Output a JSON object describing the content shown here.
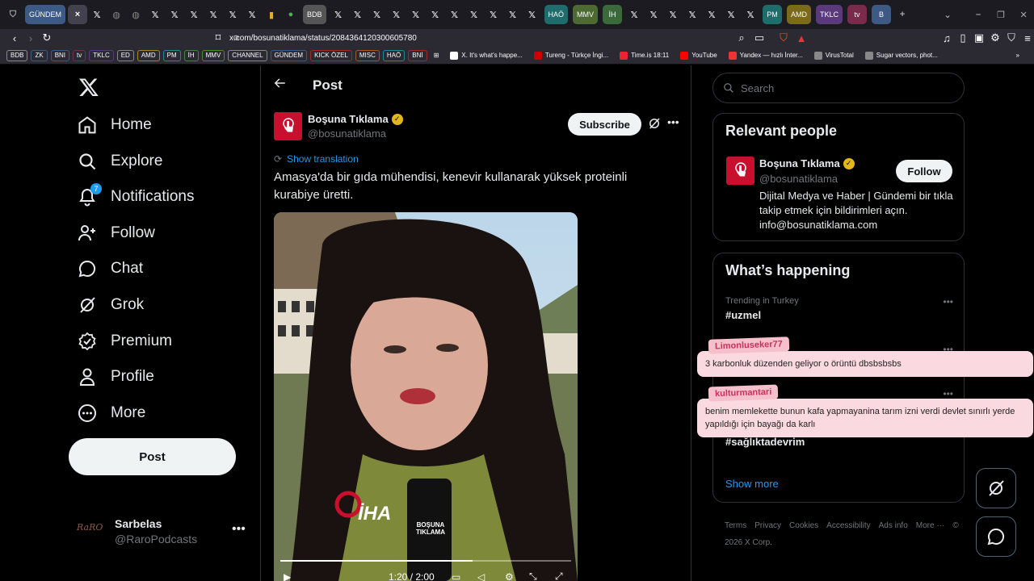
{
  "browser": {
    "tabs_labeled": [
      "GÜNDEM",
      "BDB",
      "HAÖ",
      "MMV",
      "İH",
      "PM",
      "AMD",
      "TKLC",
      "tv",
      "B"
    ],
    "tab_colors": {
      "GÜNDEM": "#3c5a84",
      "BDB": "#555",
      "HAÖ": "#1f6c6c",
      "MMV": "#4c6a32",
      "İH": "#3a6a3a",
      "PM": "#1f6c6c",
      "AMD": "#7a6a1a",
      "TKLC": "#5a3a7a",
      "tv": "#7a2a4a",
      "B": "#3c5a84"
    },
    "url": "x.com/bosunatiklama/status/2084364120300605780",
    "bookmarks_boxed": [
      "BDB",
      "ZK",
      "BNI",
      "tv",
      "TKLC",
      "ED",
      "AMD",
      "PM",
      "İH",
      "MMV",
      "CHANNEL",
      "GÜNDEM",
      "KICK ÖZEL",
      "MISC",
      "HAÖ",
      "BNİ"
    ],
    "bookmark_colors": {
      "BDB": "#888",
      "ZK": "#3c5a84",
      "BNI": "#3c5a84",
      "tv": "#7a2a4a",
      "TKLC": "#5a3a7a",
      "ED": "#888",
      "AMD": "#a08a20",
      "PM": "#1f8c8c",
      "İH": "#3a8a3a",
      "MMV": "#4c8a32",
      "CHANNEL": "#888",
      "GÜNDEM": "#3c5a84",
      "KICK ÖZEL": "#a02a2a",
      "MISC": "#a05a20",
      "HAÖ": "#1f8c8c",
      "BNİ": "#a02a2a"
    },
    "bookmark_links": [
      "X. It's what's happe...",
      "Tureng - Türkçe İngi...",
      "Time.is 18:11",
      "YouTube",
      "Yandex — hızlı İnter...",
      "VirusTotal",
      "Sugar vectors, phot..."
    ]
  },
  "nav": {
    "items": [
      {
        "label": "Home",
        "icon": "home-icon"
      },
      {
        "label": "Explore",
        "icon": "search-icon"
      },
      {
        "label": "Notifications",
        "icon": "bell-icon",
        "badge": "7"
      },
      {
        "label": "Follow",
        "icon": "follow-icon"
      },
      {
        "label": "Chat",
        "icon": "chat-icon"
      },
      {
        "label": "Grok",
        "icon": "grok-icon"
      },
      {
        "label": "Premium",
        "icon": "premium-icon"
      },
      {
        "label": "Profile",
        "icon": "profile-icon"
      },
      {
        "label": "More",
        "icon": "more-icon"
      }
    ],
    "post_label": "Post"
  },
  "account": {
    "name": "Sarbelas",
    "handle": "@RaroPodcasts",
    "avatar_text": "RaRO"
  },
  "post": {
    "header_title": "Post",
    "author_name": "Boşuna Tıklama",
    "author_handle": "@bosunatiklama",
    "subscribe_label": "Subscribe",
    "show_translation": "Show translation",
    "text": "Amasya'da bir gıda mühendisi, kenevir kullanarak yüksek proteinli kurabiye üretti.",
    "video_time": "1:20 / 2:00",
    "video_progress": 0.66,
    "video_brand_1": "İHA",
    "video_brand_2": "BOŞUNA TIKLAMA"
  },
  "search": {
    "placeholder": "Search"
  },
  "relevant": {
    "title": "Relevant people",
    "name": "Boşuna Tıklama",
    "handle": "@bosunatiklama",
    "follow_label": "Follow",
    "bio": "Dijital Medya ve Haber | Gündemi bir tıkla takip etmek için bildirimleri açın. info@bosunatiklama.com"
  },
  "happening": {
    "title": "What’s happening",
    "trends": [
      {
        "context": "Trending in Turkey",
        "tag": "#uzmel"
      },
      {
        "context": "",
        "tag": ""
      },
      {
        "context": "",
        "tag": ""
      },
      {
        "context": "",
        "tag": "#sağlıktadevrim"
      }
    ],
    "show_more": "Show more"
  },
  "footer": [
    "Terms",
    "Privacy",
    "Cookies",
    "Accessibility",
    "Ads info",
    "More ···",
    "© 2026 X Corp."
  ],
  "overlays": [
    {
      "user": "Limonluseker77",
      "msg": "3 karbonluk düzenden geliyor o örüntü dbsbsbsbs"
    },
    {
      "user": "kulturmantari",
      "msg": "benim memlekette bunun kafa yapmayanina tarım izni verdi devlet sınırlı yerde yapıldığı için bayağı da karlı"
    }
  ]
}
